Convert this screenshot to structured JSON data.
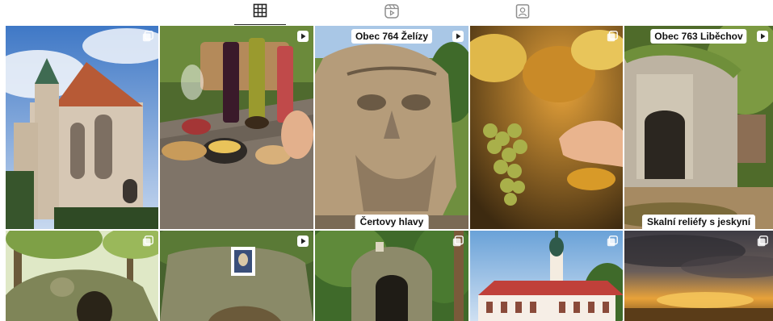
{
  "tabs": [
    {
      "name": "tab-posts",
      "icon": "grid-icon",
      "active": true
    },
    {
      "name": "tab-reels",
      "icon": "reels-icon",
      "active": false
    },
    {
      "name": "tab-tagged",
      "icon": "tagged-user-icon",
      "active": false
    }
  ],
  "posts": [
    {
      "subject": "gothic-church",
      "badge": "carousel-icon"
    },
    {
      "subject": "wine-tasting",
      "badge": "play-icon"
    },
    {
      "subject": "carved-rock-face",
      "badge": "play-icon",
      "caption_top": "Obec 764 Želízy",
      "caption_bottom": "Čertovy hlavy"
    },
    {
      "subject": "vineyard-grapes",
      "badge": "carousel-icon"
    },
    {
      "subject": "rock-chapel",
      "badge": "play-icon",
      "caption_top": "Obec 763 Liběchov",
      "caption_bottom": "Skalní reliéfy s jeskyní"
    },
    {
      "subject": "forest-rock-relief",
      "badge": "carousel-icon"
    },
    {
      "subject": "rock-shrine-painting",
      "badge": "play-icon"
    },
    {
      "subject": "rock-grotto",
      "badge": "carousel-icon"
    },
    {
      "subject": "baroque-chateau",
      "badge": "carousel-icon"
    },
    {
      "subject": "sunset-landscape",
      "badge": "carousel-icon"
    }
  ],
  "colors": {
    "active_tab": "#262626",
    "inactive_tab": "#8e8e8e"
  }
}
